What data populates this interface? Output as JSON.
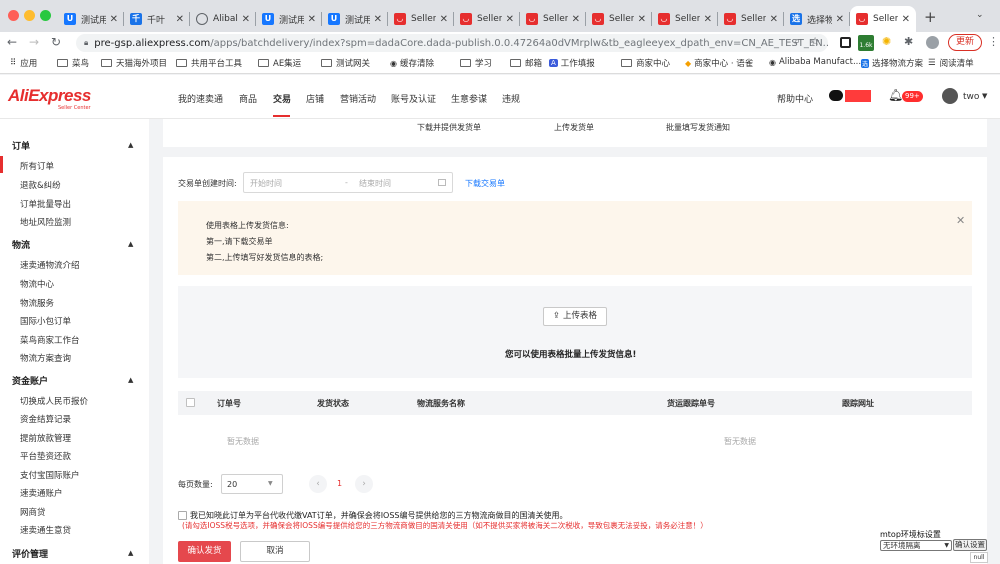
{
  "browser": {
    "tabs": [
      {
        "title": "测试用",
        "icon": "U",
        "color": "#1677ff"
      },
      {
        "title": "千叶",
        "icon": "千",
        "color": "#1a73e8"
      },
      {
        "title": "Alibal",
        "icon": "globe",
        "color": "#5f6368"
      },
      {
        "title": "测试用",
        "icon": "U",
        "color": "#1677ff"
      },
      {
        "title": "测试用",
        "icon": "U",
        "color": "#1677ff"
      },
      {
        "title": "Seller",
        "icon": "ae",
        "color": "#e62e2e"
      },
      {
        "title": "Seller",
        "icon": "ae",
        "color": "#e62e2e"
      },
      {
        "title": "Seller",
        "icon": "ae",
        "color": "#e62e2e"
      },
      {
        "title": "Seller",
        "icon": "ae",
        "color": "#e62e2e"
      },
      {
        "title": "Seller",
        "icon": "ae",
        "color": "#e62e2e"
      },
      {
        "title": "Seller",
        "icon": "ae",
        "color": "#e62e2e"
      },
      {
        "title": "选择物",
        "icon": "选",
        "color": "#1a73e8"
      },
      {
        "title": "Seller",
        "icon": "ae",
        "color": "#e62e2e"
      }
    ],
    "url_prefix": "pre-gsp.aliexpress.com",
    "url_rest": "/apps/batchdelivery/index?spm=dadaCore.dada-publish.0.0.47264a0dVMrplw&tb_eagleeyex_dpath_env=CN_AE_TEST_EN...",
    "update_label": "更新",
    "ext_badge": "1.6k",
    "bookmarks": [
      "应用",
      "菜鸟",
      "天猫海外项目",
      "共用平台工具",
      "AE集运",
      "测试网关",
      "缓存清除",
      "学习",
      "邮箱",
      "工作填报",
      "商家中心",
      "商家中心 · 语雀",
      "Alibaba Manufact...",
      "选择物流方案"
    ],
    "reading_list": "阅读清单"
  },
  "header": {
    "logo": "AliExpress",
    "logo_sub": "Seller Center",
    "nav": [
      "我的速卖通",
      "商品",
      "交易",
      "店铺",
      "营销活动",
      "账号及认证",
      "生意参谋",
      "违规"
    ],
    "active_nav": "交易",
    "help": "帮助中心",
    "notif_badge": "99+",
    "user": "two"
  },
  "sidebar": [
    {
      "group": "订单",
      "items": [
        "所有订单",
        "退款&纠纷",
        "订单批量导出",
        "地址风险监测"
      ]
    },
    {
      "group": "物流",
      "items": [
        "速卖通物流介绍",
        "物流中心",
        "物流服务",
        "国际小包订单",
        "菜鸟商家工作台",
        "物流方案查询"
      ]
    },
    {
      "group": "资金账户",
      "items": [
        "切换成人民币报价",
        "资金结算记录",
        "提前放款管理",
        "平台垫资还款",
        "支付宝国际账户",
        "速卖通账户",
        "网商贷",
        "速卖通生意贷"
      ]
    },
    {
      "group": "评价管理",
      "items": []
    }
  ],
  "steps": [
    "下载并提供发货单",
    "上传发货单",
    "批量填写发货通知"
  ],
  "filter": {
    "label": "交易单创建时间:",
    "start_placeholder": "开始时间",
    "separator": "-",
    "end_placeholder": "结束时间",
    "download_link": "下载交易单"
  },
  "notice": {
    "lines": [
      "使用表格上传发货信息:",
      "第一,请下载交易单",
      "第二,上传填写好发货信息的表格;"
    ]
  },
  "upload": {
    "button": "上传表格",
    "hint": "您可以使用表格批量上传发货信息!"
  },
  "table": {
    "columns": [
      "订单号",
      "发货状态",
      "物流服务名称",
      "货运跟踪单号",
      "跟踪网址"
    ],
    "empty_left": "暂无数据",
    "empty_right": "暂无数据"
  },
  "pagination": {
    "page_size_label": "每页数量:",
    "page_size": "20",
    "current_page": "1"
  },
  "ioss": {
    "text": "我已知晓此订单为平台代收代缴VAT订单，并确保会将IOSS编号提供给您的三方物流商做目的国清关使用。",
    "warning": "(请勾选IOSS税号选项，并确保会将IOSS编号提供给您的三方物流商做目的国清关使用（如不提供买家将被海关二次税收，导致包裹无法妥投，请务必注意！）"
  },
  "actions": {
    "confirm": "确认发货",
    "cancel": "取消"
  },
  "mtop": {
    "label": "mtop环境标设置",
    "option": "无环境隔离",
    "button": "确认设置",
    "null_label": "null"
  }
}
